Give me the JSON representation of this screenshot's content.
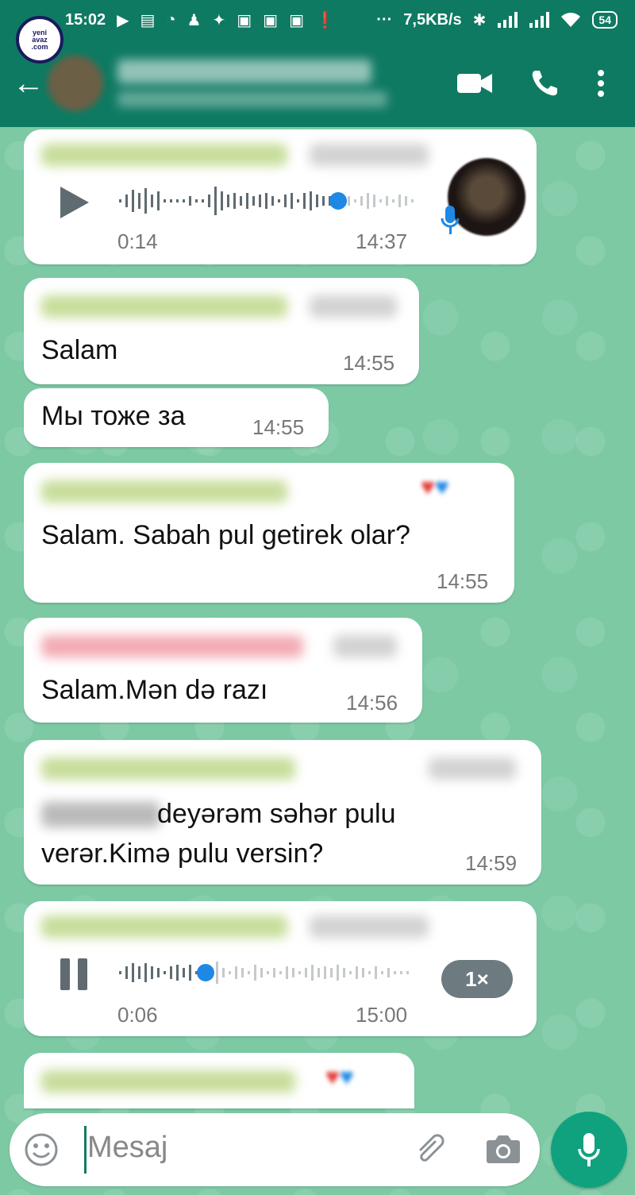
{
  "status_bar": {
    "time": "15:02",
    "network_speed": "7,5KB/s",
    "battery": "54"
  },
  "logo": {
    "line1": "yeni",
    "line2": "avaz",
    "line3": ".com",
    "letter": "a"
  },
  "messages": [
    {
      "type": "audio",
      "duration": "0:14",
      "time": "14:37",
      "progress": 0.72
    },
    {
      "type": "text",
      "text": "Salam",
      "time": "14:55"
    },
    {
      "type": "text",
      "text": "Мы тоже за",
      "time": "14:55"
    },
    {
      "type": "text",
      "text": "Salam. Sabah pul getirek olar?",
      "time": "14:55"
    },
    {
      "type": "text",
      "text": "Salam.Mən də razı",
      "time": "14:56"
    },
    {
      "type": "text",
      "text_line1": "deyərəm səhər pulu",
      "text_line2": "verər.Kimə pulu versin?",
      "time": "14:59"
    },
    {
      "type": "audio",
      "duration": "0:06",
      "time": "15:00",
      "progress": 0.3,
      "speed": "1×"
    }
  ],
  "input": {
    "placeholder": "Mesaj"
  },
  "colors": {
    "header": "#0f7a62",
    "wallpaper": "#7cc9a4",
    "accent": "#1e88e5",
    "mic": "#10a27f"
  },
  "icons": {
    "back": "back-arrow-icon",
    "video": "video-call-icon",
    "phone": "phone-icon",
    "menu": "more-options-icon",
    "emoji": "emoji-icon",
    "attach": "attach-icon",
    "camera": "camera-icon",
    "mic": "mic-icon"
  }
}
